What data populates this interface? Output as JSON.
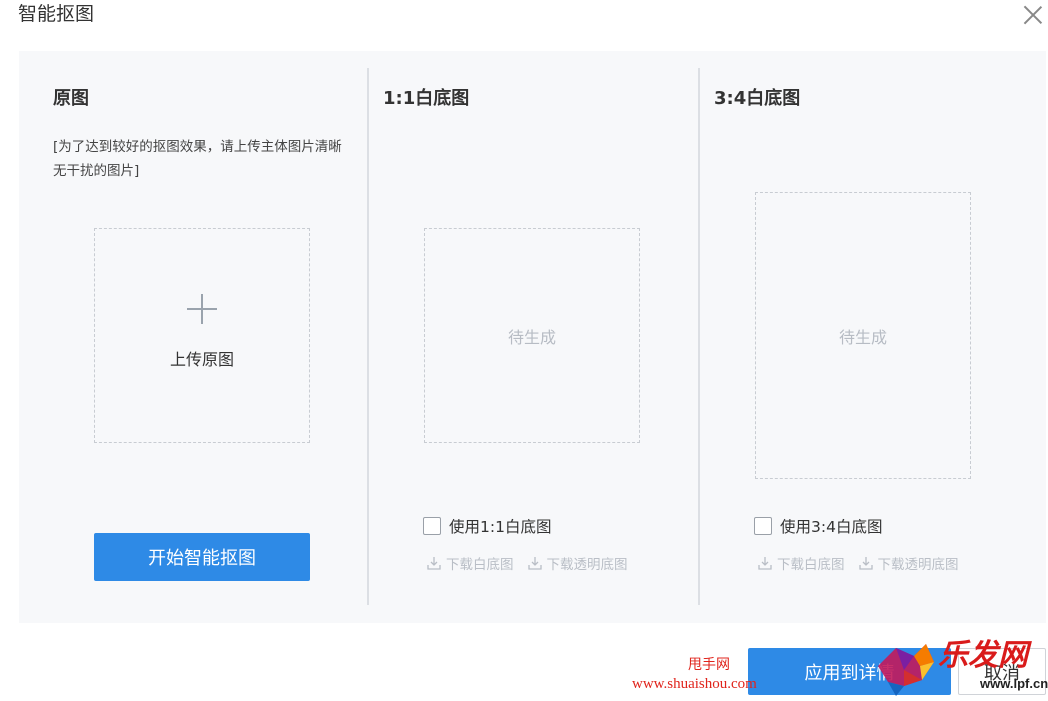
{
  "dialog": {
    "title": "智能抠图"
  },
  "original": {
    "title": "原图",
    "hint": "[为了达到较好的抠图效果，请上传主体图片清晰无干扰的图片]",
    "upload_label": "上传原图",
    "start_button": "开始智能抠图"
  },
  "square": {
    "title": "1:1白底图",
    "placeholder": "待生成",
    "checkbox_label": "使用1:1白底图",
    "download_white": "下载白底图",
    "download_transparent": "下载透明底图"
  },
  "portrait": {
    "title": "3:4白底图",
    "placeholder": "待生成",
    "checkbox_label": "使用3:4白底图",
    "download_white": "下载白底图",
    "download_transparent": "下载透明底图"
  },
  "footer": {
    "apply_button": "应用到详情",
    "cancel_button": "取消"
  },
  "watermark": {
    "site_name": "甩手网",
    "site_url": "www.shuaishou.com",
    "logo_text": "乐发网",
    "logo_url": "www.lpf.cn"
  },
  "colors": {
    "primary": "#2e8ae6",
    "panel_bg": "#f7f8fa",
    "watermark_red": "#e0241c"
  }
}
